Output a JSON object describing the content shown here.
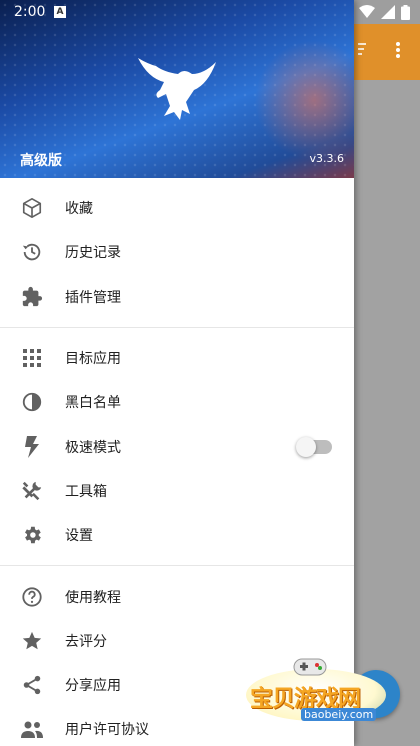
{
  "status_bar": {
    "time": "2:00",
    "notification_badge": "A"
  },
  "drawer": {
    "header": {
      "edition": "高级版",
      "version": "v3.3.6"
    },
    "sections": [
      {
        "items": [
          {
            "icon": "cube-icon",
            "label": "收藏"
          },
          {
            "icon": "history-icon",
            "label": "历史记录"
          },
          {
            "icon": "puzzle-icon",
            "label": "插件管理"
          }
        ]
      },
      {
        "items": [
          {
            "icon": "grid-icon",
            "label": "目标应用"
          },
          {
            "icon": "half-circle-icon",
            "label": "黑白名单"
          },
          {
            "icon": "lightning-icon",
            "label": "极速模式",
            "toggle": false
          },
          {
            "icon": "tools-icon",
            "label": "工具箱"
          },
          {
            "icon": "gear-icon",
            "label": "设置"
          }
        ]
      },
      {
        "items": [
          {
            "icon": "help-icon",
            "label": "使用教程"
          },
          {
            "icon": "star-icon",
            "label": "去评分"
          },
          {
            "icon": "share-icon",
            "label": "分享应用"
          },
          {
            "icon": "people-icon",
            "label": "用户许可协议"
          }
        ]
      }
    ]
  },
  "watermark": {
    "title": "宝贝游戏网",
    "url": "baobeiy.com"
  },
  "colors": {
    "appbar": "#e0902a",
    "fab": "#2d84c9",
    "icon": "#616161"
  }
}
